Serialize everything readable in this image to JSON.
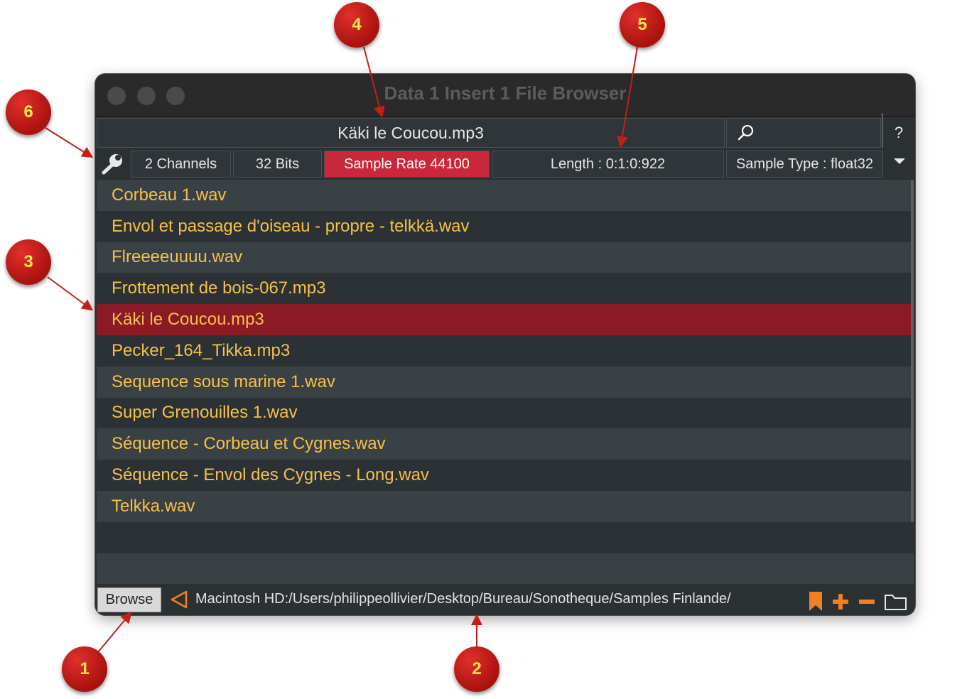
{
  "window": {
    "title": "Data 1 Insert 1 File Browser"
  },
  "header": {
    "current_file": "Käki le Coucou.mp3",
    "help_label": "?"
  },
  "info": {
    "channels": "2 Channels",
    "bits": "32 Bits",
    "sample_rate": "Sample Rate 44100",
    "length": "Length : 0:1:0:922",
    "sample_type": "Sample Type : float32"
  },
  "files": [
    "Corbeau 1.wav",
    "Envol et passage d'oiseau - propre - telkkä.wav",
    "Flreeeeuuuu.wav",
    "Frottement de bois-067.mp3",
    "Käki le Coucou.mp3",
    "Pecker_164_Tikka.mp3",
    "Sequence sous marine 1.wav",
    "Super Grenouilles 1.wav",
    "Séquence - Corbeau et Cygnes.wav",
    "Séquence - Envol des Cygnes - Long.wav",
    "Telkka.wav"
  ],
  "selected_index": 4,
  "bottom": {
    "browse_label": "Browse",
    "path": "Macintosh HD:/Users/philippeollivier/Desktop/Bureau/Sonotheque/Samples Finlande/"
  },
  "callouts": {
    "c1": "1",
    "c2": "2",
    "c3": "3",
    "c4": "4",
    "c5": "5",
    "c6": "6"
  },
  "colors": {
    "file_text": "#f5c04a",
    "selected_row": "#8b1a25",
    "sample_rate_bg": "#c8283a",
    "accent_orange": "#f08020",
    "callout_red": "#c41e1a",
    "callout_text": "#ffe94a"
  },
  "icons": [
    "search-icon",
    "wrench-icon",
    "dropdown-arrow-icon",
    "back-arrow-icon",
    "bookmark-icon",
    "plus-icon",
    "minus-icon",
    "folder-icon"
  ]
}
